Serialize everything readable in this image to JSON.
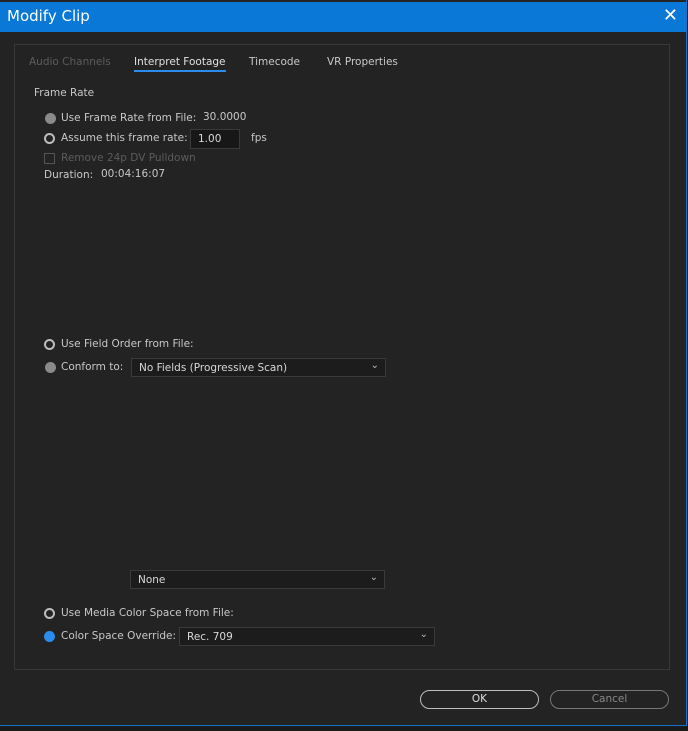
{
  "title": "Modify Clip",
  "tabs": [
    "Audio Channels",
    "Interpret Footage",
    "Timecode",
    "VR Properties"
  ],
  "frame_rate": {
    "heading": "Frame Rate",
    "use_file_label": "Use Frame Rate from File:",
    "file_rate": "30.0000",
    "assume_label": "Assume this frame rate:",
    "assume_value": "1.00",
    "fps": "fps",
    "pulldown_label": "Remove 24p DV Pulldown",
    "duration_label": "Duration:",
    "duration": "00:04:16:07"
  },
  "field_order": {
    "use_file_label": "Use Field Order from File:",
    "conform_label": "Conform to:",
    "conform_value": "No Fields (Progressive Scan)"
  },
  "alpha_select": "None",
  "color": {
    "use_file_label": "Use Media Color Space from File:",
    "override_label": "Color Space Override:",
    "override_value": "Rec. 709"
  },
  "buttons": {
    "ok": "OK",
    "cancel": "Cancel"
  }
}
